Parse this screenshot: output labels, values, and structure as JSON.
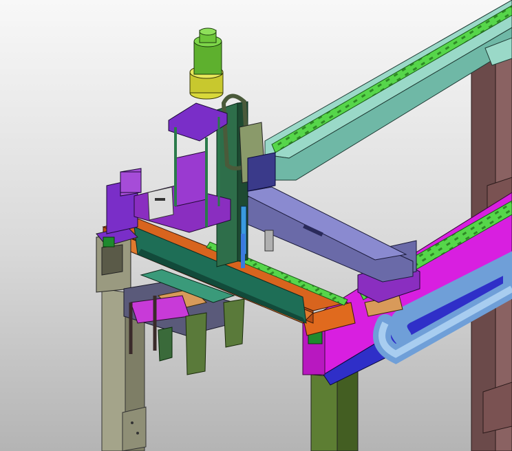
{
  "scene": {
    "view": "isometric",
    "render_style": "shaded-with-edges",
    "background_gradient": [
      "#f8f8f8",
      "#d9d9d9",
      "#b4b4b4"
    ],
    "assembly": "gantry-robot",
    "colors": {
      "green_rail_beam": "#7ac9b8",
      "linear_guide": "#56d64a",
      "left_post": "#8f8f78",
      "center_post": "#4e6b2a",
      "right_post": "#6b4a4a",
      "magenta_beam": "#d81fe0",
      "blue_side": "#2f2fc8",
      "cable_chain": "#8fb8e8",
      "cross_beam_top": "#d8641e",
      "cross_beam_front": "#1e6e56",
      "carriage_plate": "#8a2ec0",
      "slide_rail": "#6a6aa8",
      "servo_motor": "#6ec63a",
      "gearbox": "#d8d83a",
      "column_plate": "#7a2ec8",
      "gripper_tooling": "#d89a5a"
    }
  }
}
